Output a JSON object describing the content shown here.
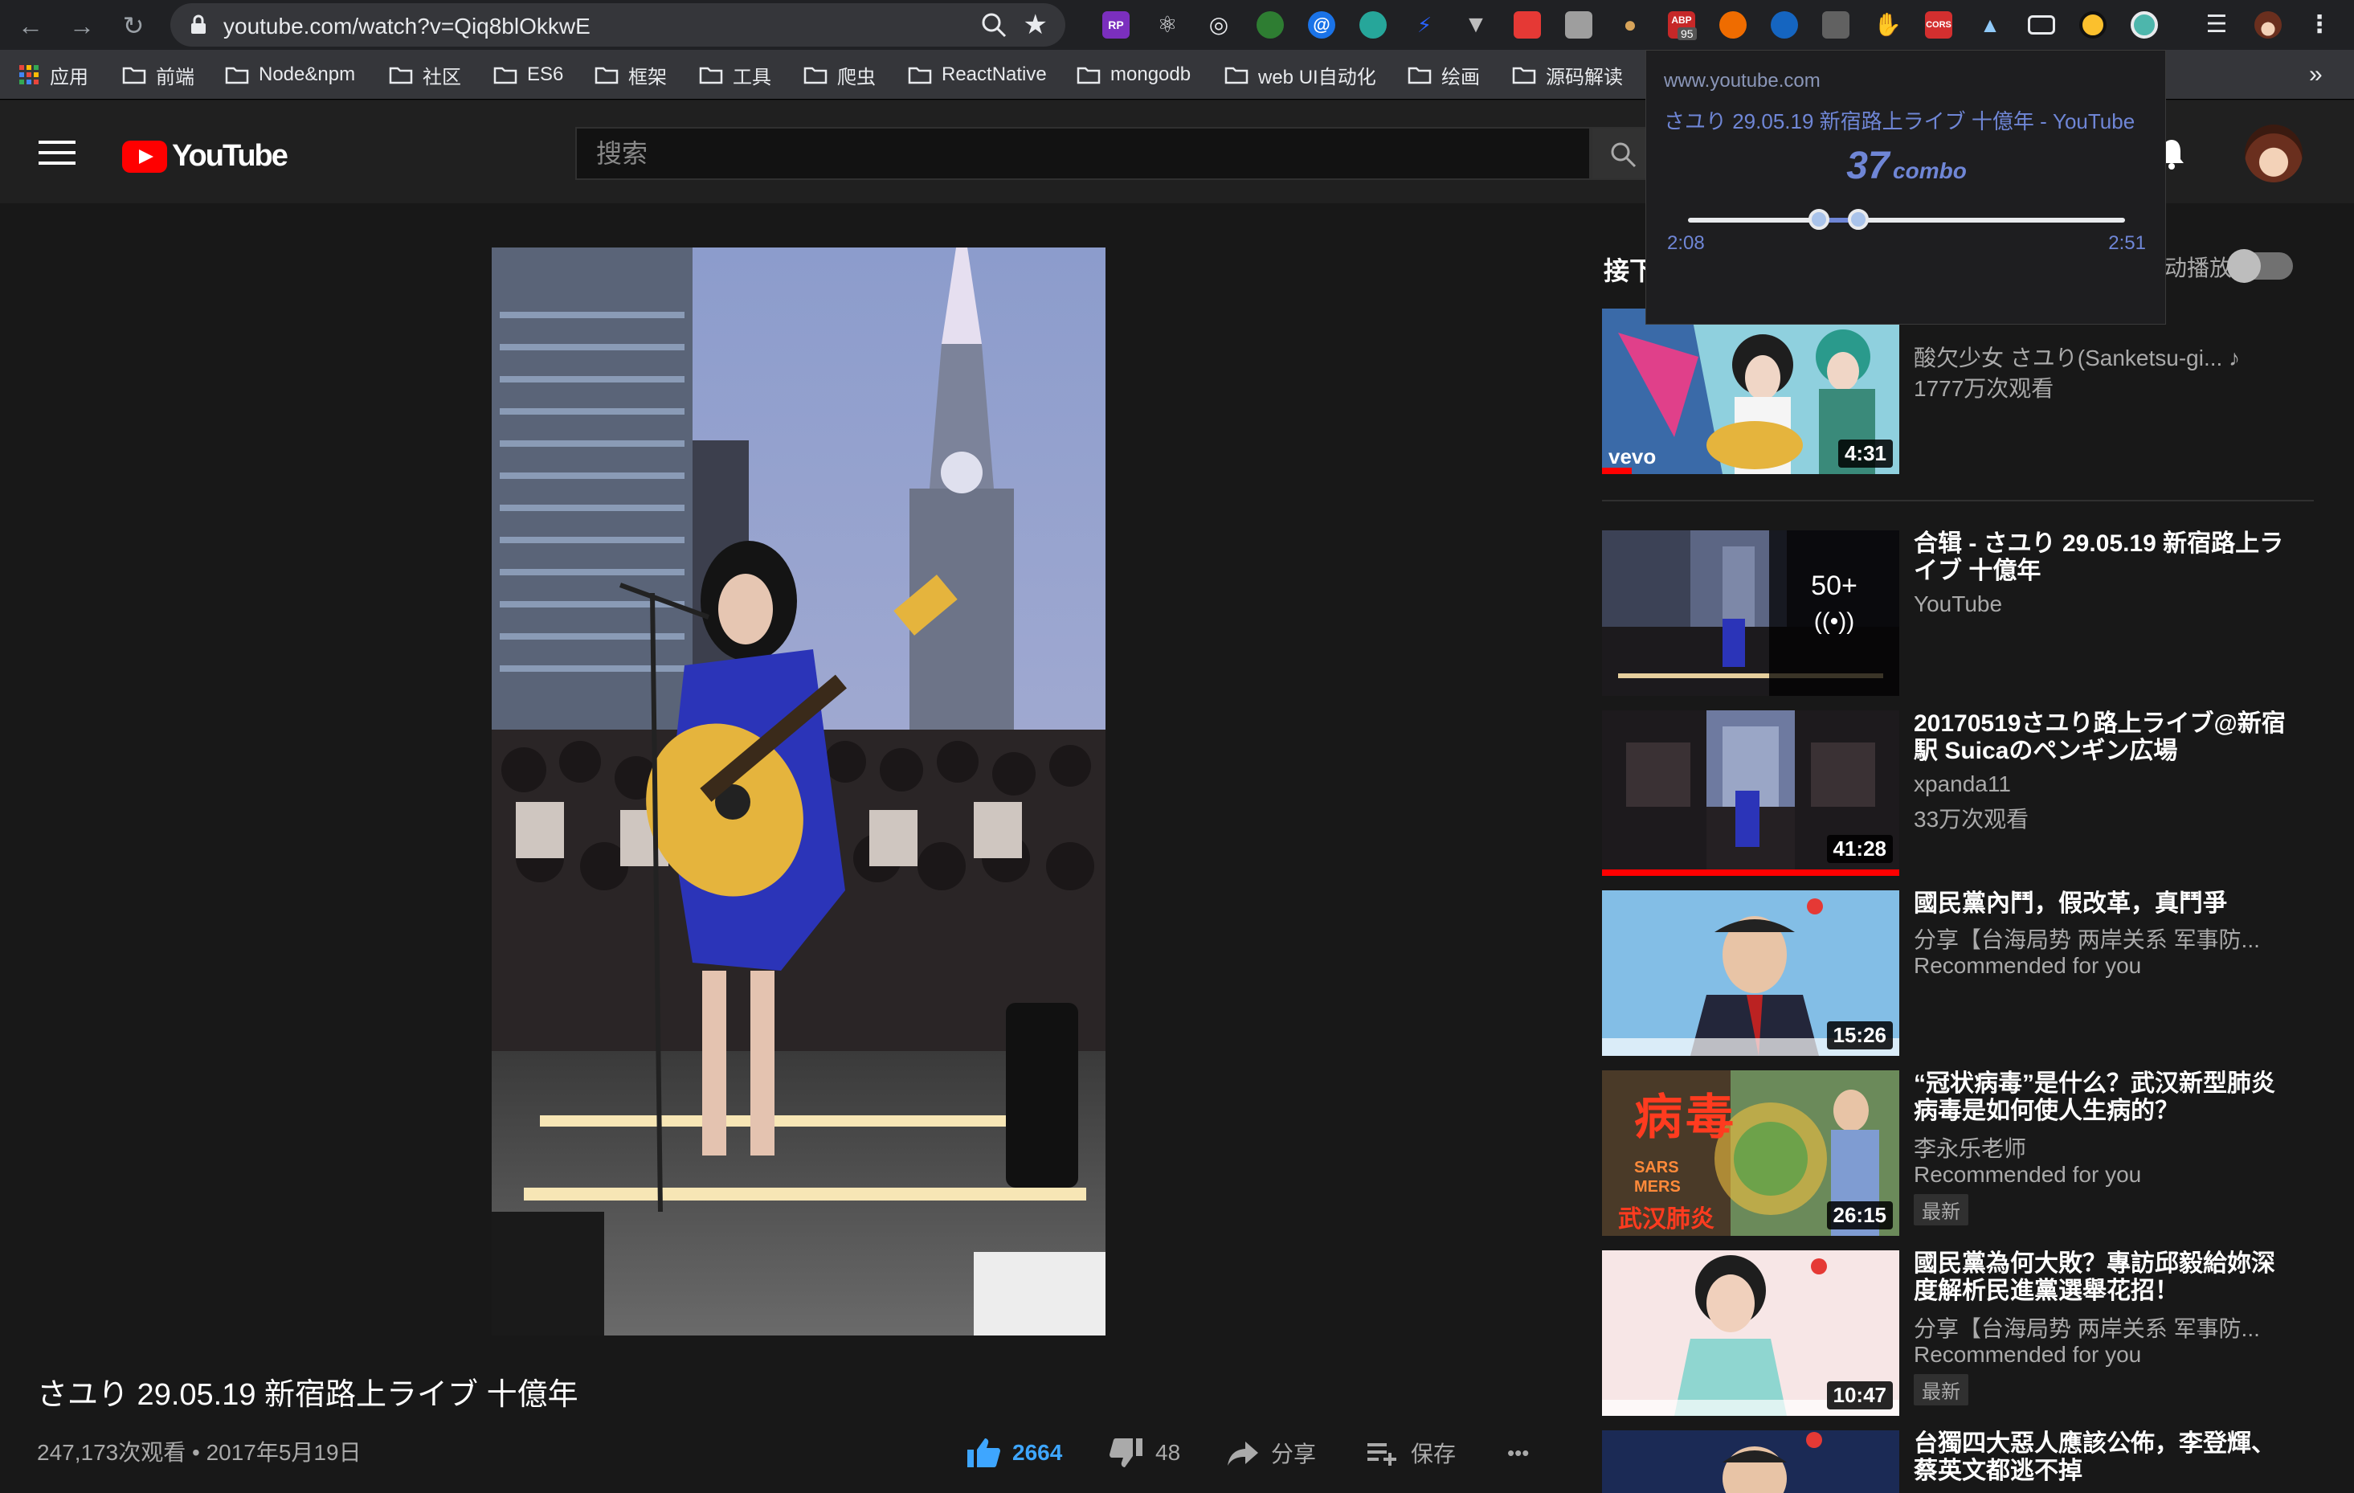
{
  "browser": {
    "url": "youtube.com/watch?v=Qiq8blOkkwE",
    "extension_badges": {
      "abp": "ABP",
      "abp_count": "95",
      "cors": "CORS",
      "rp": "RP"
    }
  },
  "bookmarks": [
    {
      "label": "应用"
    },
    {
      "label": "前端"
    },
    {
      "label": "Node&npm"
    },
    {
      "label": "社区"
    },
    {
      "label": "ES6"
    },
    {
      "label": "框架"
    },
    {
      "label": "工具"
    },
    {
      "label": "爬虫"
    },
    {
      "label": "ReactNative"
    },
    {
      "label": "mongodb"
    },
    {
      "label": "web UI自动化"
    },
    {
      "label": "绘画"
    },
    {
      "label": "源码解读"
    }
  ],
  "bookmarks_overflow": "»",
  "header": {
    "logo_text": "YouTube",
    "search_placeholder": "搜索"
  },
  "video": {
    "title": "さユり 29.05.19 新宿路上ライブ 十億年",
    "meta": "247,173次观看 • 2017年5月19日",
    "likes": "2664",
    "dislikes": "48",
    "share_label": "分享",
    "save_label": "保存",
    "more_label": "•••"
  },
  "sidebar": {
    "upnext_label": "接下",
    "autoplay_label": "动播放",
    "items": [
      {
        "title": "",
        "channel": "酸欠少女 さユり(Sanketsu-gi... ♪",
        "views": "1777万次观看",
        "duration": "4:31",
        "thumb_tag": "vevo",
        "watched_fraction": 0.1
      },
      {
        "title": "合辑 - さユり 29.05.19 新宿路上ライブ 十億年",
        "channel": "YouTube",
        "playlist_count": "50+",
        "playlist_icon": "((•))"
      },
      {
        "title": "20170519さユり路上ライブ@新宿駅 Suicaのペンギン広場",
        "channel": "xpanda11",
        "views": "33万次观看",
        "duration": "41:28",
        "watched_fraction": 1.0
      },
      {
        "title": "國民黨內鬥，假改革，真鬥爭",
        "channel": "分享【台海局势 两岸关系 军事防...",
        "views": "Recommended for you",
        "duration": "15:26"
      },
      {
        "title": "“冠状病毒”是什么？武汉新型肺炎病毒是如何使人生病的？",
        "channel": "李永乐老师",
        "views": "Recommended for you",
        "badge": "最新",
        "duration": "26:15",
        "thumb_text_1": "病毒",
        "thumb_text_2": "SARS",
        "thumb_text_3": "MERS",
        "thumb_text_4": "武汉肺炎"
      },
      {
        "title": "國民黨為何大敗？專訪邱毅給妳深度解析民進黨選舉花招！",
        "channel": "分享【台海局势 两岸关系 军事防...",
        "views": "Recommended for you",
        "badge": "最新",
        "duration": "10:47"
      },
      {
        "title": "台獨四大惡人應該公佈，李登輝、蔡英文都逃不掉",
        "channel": ""
      }
    ]
  },
  "popup": {
    "domain": "www.youtube.com",
    "title": "さユり 29.05.19 新宿路上ライブ 十億年 - YouTube",
    "combo_count": "37",
    "combo_word": "combo",
    "time_start": "2:08",
    "time_end": "2:51",
    "range_start_fraction": 0.3,
    "range_end_fraction": 0.39
  }
}
